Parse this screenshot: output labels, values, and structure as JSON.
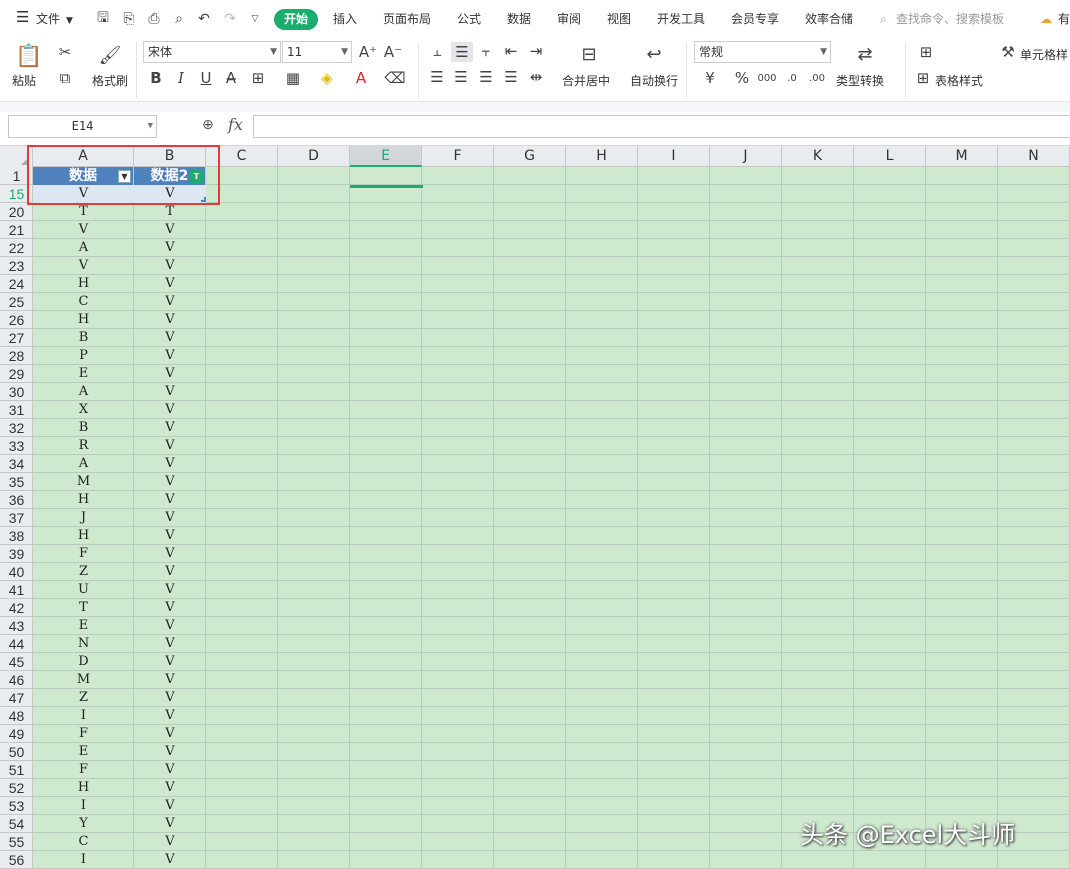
{
  "menu": {
    "file_label": "文件",
    "tabs": [
      "开始",
      "插入",
      "页面布局",
      "公式",
      "数据",
      "审阅",
      "视图",
      "开发工具",
      "会员专享",
      "效率合储"
    ],
    "search_placeholder": "查找命令、搜索模板",
    "right_cut": "有"
  },
  "ribbon": {
    "paste": "粘贴",
    "format_painter": "格式刷",
    "font_name": "宋体",
    "font_size": "11",
    "merge_center": "合并居中",
    "wrap_text": "自动换行",
    "number_format": "常规",
    "type_convert": "类型转换",
    "table_style": "表格样式",
    "cell_style": "单元格样"
  },
  "formula_bar": {
    "name_box": "E14",
    "fx": "fx",
    "formula": ""
  },
  "sheet": {
    "columns": [
      "A",
      "B",
      "C",
      "D",
      "E",
      "F",
      "G",
      "H",
      "I",
      "J",
      "K",
      "L",
      "M",
      "N"
    ],
    "header_row_number": "1",
    "headers": [
      "数据",
      "数据2"
    ],
    "selected_column": "E",
    "rows": [
      {
        "n": "15",
        "a": "V",
        "b": "V"
      },
      {
        "n": "20",
        "a": "T",
        "b": "T"
      },
      {
        "n": "21",
        "a": "V",
        "b": "V"
      },
      {
        "n": "22",
        "a": "A",
        "b": "V"
      },
      {
        "n": "23",
        "a": "V",
        "b": "V"
      },
      {
        "n": "24",
        "a": "H",
        "b": "V"
      },
      {
        "n": "25",
        "a": "C",
        "b": "V"
      },
      {
        "n": "26",
        "a": "H",
        "b": "V"
      },
      {
        "n": "27",
        "a": "B",
        "b": "V"
      },
      {
        "n": "28",
        "a": "P",
        "b": "V"
      },
      {
        "n": "29",
        "a": "E",
        "b": "V"
      },
      {
        "n": "30",
        "a": "A",
        "b": "V"
      },
      {
        "n": "31",
        "a": "X",
        "b": "V"
      },
      {
        "n": "32",
        "a": "B",
        "b": "V"
      },
      {
        "n": "33",
        "a": "R",
        "b": "V"
      },
      {
        "n": "34",
        "a": "A",
        "b": "V"
      },
      {
        "n": "35",
        "a": "M",
        "b": "V"
      },
      {
        "n": "36",
        "a": "H",
        "b": "V"
      },
      {
        "n": "37",
        "a": "J",
        "b": "V"
      },
      {
        "n": "38",
        "a": "H",
        "b": "V"
      },
      {
        "n": "39",
        "a": "F",
        "b": "V"
      },
      {
        "n": "40",
        "a": "Z",
        "b": "V"
      },
      {
        "n": "41",
        "a": "U",
        "b": "V"
      },
      {
        "n": "42",
        "a": "T",
        "b": "V"
      },
      {
        "n": "43",
        "a": "E",
        "b": "V"
      },
      {
        "n": "44",
        "a": "N",
        "b": "V"
      },
      {
        "n": "45",
        "a": "D",
        "b": "V"
      },
      {
        "n": "46",
        "a": "M",
        "b": "V"
      },
      {
        "n": "47",
        "a": "Z",
        "b": "V"
      },
      {
        "n": "48",
        "a": "I",
        "b": "V"
      },
      {
        "n": "49",
        "a": "F",
        "b": "V"
      },
      {
        "n": "50",
        "a": "E",
        "b": "V"
      },
      {
        "n": "51",
        "a": "F",
        "b": "V"
      },
      {
        "n": "52",
        "a": "H",
        "b": "V"
      },
      {
        "n": "53",
        "a": "I",
        "b": "V"
      },
      {
        "n": "54",
        "a": "Y",
        "b": "V"
      },
      {
        "n": "55",
        "a": "C",
        "b": "V"
      },
      {
        "n": "56",
        "a": "I",
        "b": "V"
      }
    ]
  },
  "watermark": "头条 @Excel大斗师",
  "colors": {
    "accent": "#1aad6d",
    "table_header": "#4f81bd",
    "sheet_bg": "#cfe9cf",
    "highlight": "#e23b3b"
  }
}
